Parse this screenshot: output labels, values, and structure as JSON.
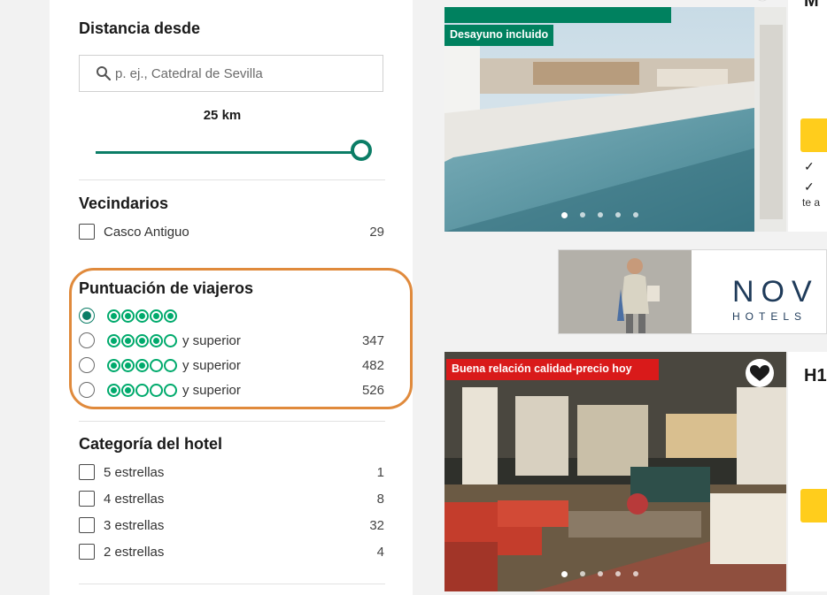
{
  "filters": {
    "distance": {
      "heading": "Distancia desde",
      "search_placeholder": "p. ej., Catedral de Sevilla",
      "value_label": "25 km",
      "slider_value_fraction": 1.0
    },
    "neighborhoods": {
      "heading": "Vecindarios",
      "items": [
        {
          "label": "Casco Antiguo",
          "count": "29"
        }
      ]
    },
    "traveler_rating": {
      "heading": "Puntuación de viajeros",
      "options": [
        {
          "bubbles": 5,
          "suffix": "",
          "count": "",
          "selected": true
        },
        {
          "bubbles": 4,
          "suffix": "y superior",
          "count": "347",
          "selected": false
        },
        {
          "bubbles": 3,
          "suffix": "y superior",
          "count": "482",
          "selected": false
        },
        {
          "bubbles": 2,
          "suffix": "y superior",
          "count": "526",
          "selected": false
        }
      ]
    },
    "hotel_class": {
      "heading": "Categoría del hotel",
      "items": [
        {
          "label": "5 estrellas",
          "count": "1"
        },
        {
          "label": "4 estrellas",
          "count": "8"
        },
        {
          "label": "3 estrellas",
          "count": "32"
        },
        {
          "label": "2 estrellas",
          "count": "4"
        }
      ]
    }
  },
  "results": {
    "card1": {
      "badge": "Desayuno incluido",
      "title_fragment": "M",
      "side_lines": [
        "✓",
        "✓",
        "te a"
      ]
    },
    "ad": {
      "brand": "NOV",
      "brand_sub": "HOTELS"
    },
    "card2": {
      "badge": "Buena relación calidad-precio hoy",
      "title_fragment": "H1"
    }
  },
  "colors": {
    "accent_green": "#0b7d66",
    "bubble_green": "#00aa6c",
    "highlight_orange": "#e08a3c",
    "badge_red": "#d91a1a",
    "cta_yellow": "#ffcd1c"
  }
}
